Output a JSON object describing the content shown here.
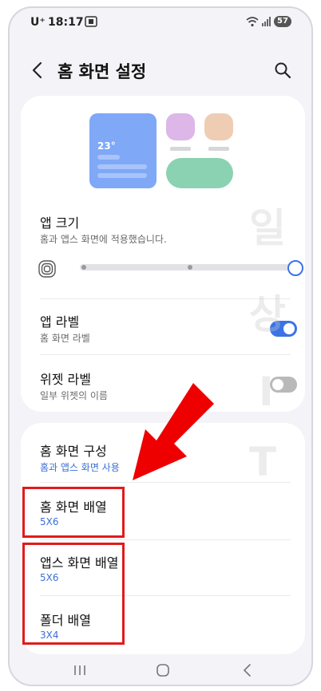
{
  "status_bar": {
    "carrier": "U⁺",
    "time": "18:17",
    "battery": "57"
  },
  "header": {
    "title": "홈 화면 설정",
    "back_icon": "back-arrow-icon",
    "search_icon": "search-icon"
  },
  "preview": {
    "temperature": "23°"
  },
  "app_size": {
    "title": "앱 크기",
    "subtitle": "홈과 앱스 화면에 적용했습니다."
  },
  "app_label": {
    "title": "앱 라벨",
    "subtitle": "홈 화면 라벨",
    "enabled": true
  },
  "widget_label": {
    "title": "위젯 라벨",
    "subtitle": "일부 위젯의 이름",
    "enabled": false
  },
  "home_layout": {
    "title": "홈 화면 구성",
    "value": "홈과 앱스 화면 사용"
  },
  "home_grid": {
    "title": "홈 화면 배열",
    "value": "5X6"
  },
  "apps_grid": {
    "title": "앱스 화면 배열",
    "value": "5X6"
  },
  "folder_grid": {
    "title": "폴더 배열",
    "value": "3X4"
  },
  "watermark": [
    "일",
    "상",
    "I",
    "T"
  ],
  "colors": {
    "accent": "#3b73e6",
    "highlight": "#e01b1b",
    "arrow": "#ee0000"
  }
}
